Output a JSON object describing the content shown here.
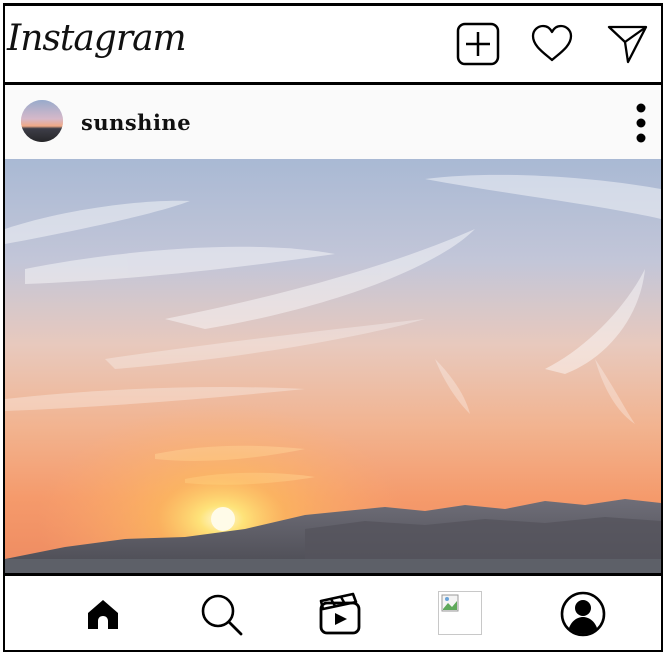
{
  "app": {
    "logo_text": "Instagram"
  },
  "header": {
    "icons": [
      "add-post-icon",
      "heart-icon",
      "send-icon"
    ]
  },
  "post": {
    "username": "sunshine",
    "avatar": "avatar",
    "more_icon": "more-vertical-icon",
    "image": "sunset-photo"
  },
  "bottom_nav": {
    "items": [
      "home-icon",
      "search-icon",
      "reels-icon",
      "broken-image",
      "profile-icon"
    ]
  },
  "colors": {
    "border": "#000000",
    "background": "#ffffff",
    "post_header_bg": "#fafafa"
  }
}
